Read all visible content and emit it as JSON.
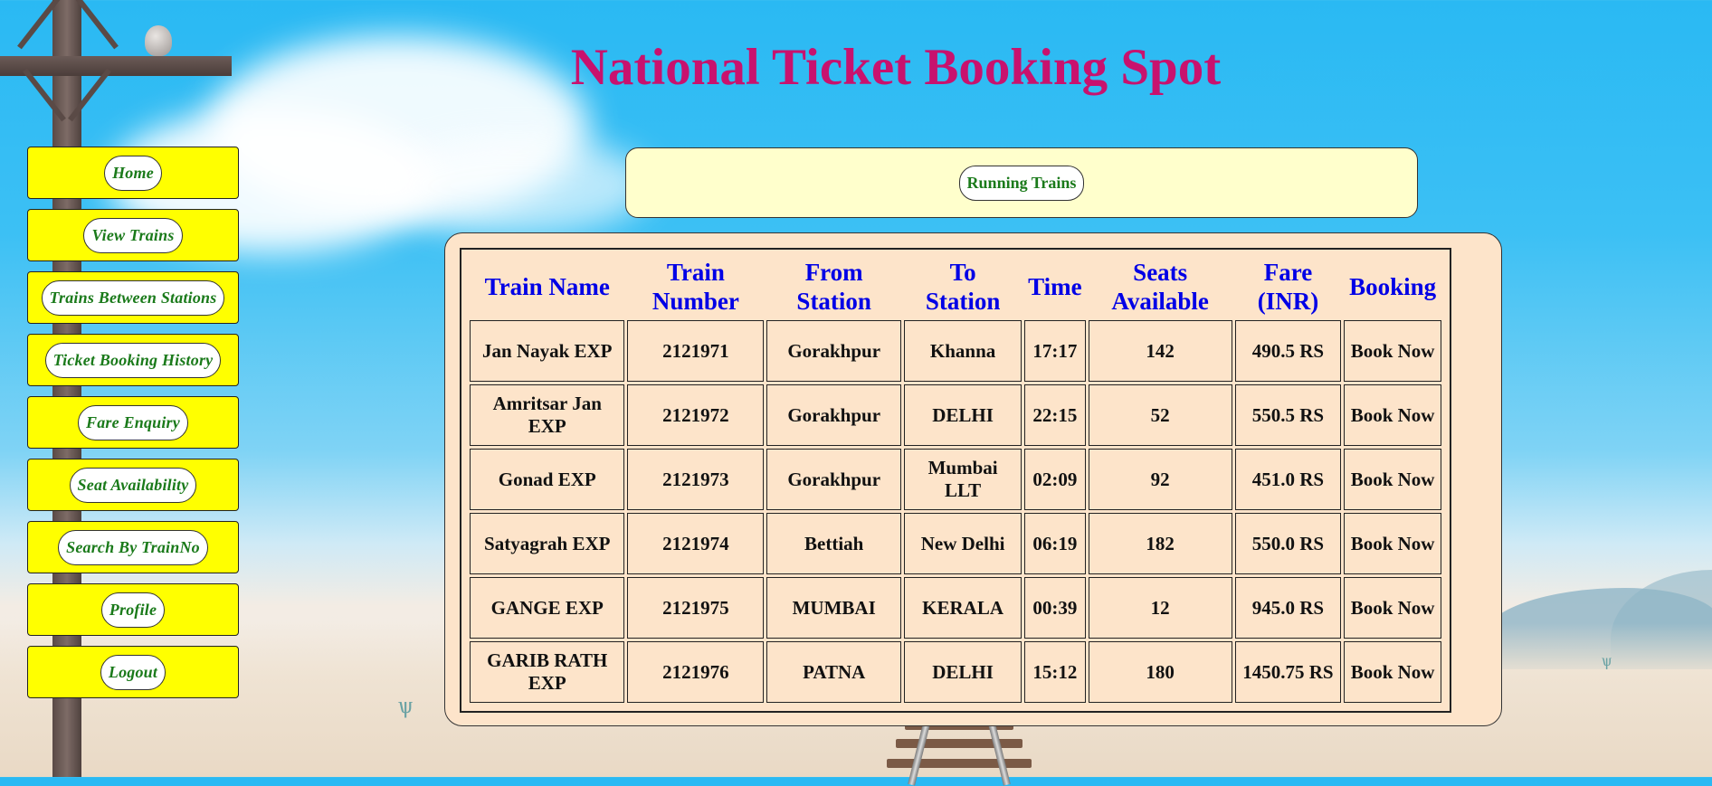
{
  "header": {
    "title": "National Ticket Booking Spot"
  },
  "sidebar": {
    "items": [
      {
        "label": "Home"
      },
      {
        "label": "View Trains"
      },
      {
        "label": "Trains Between Stations"
      },
      {
        "label": "Ticket Booking History"
      },
      {
        "label": "Fare Enquiry"
      },
      {
        "label": "Seat Availability"
      },
      {
        "label": "Search By TrainNo"
      },
      {
        "label": "Profile"
      },
      {
        "label": "Logout"
      }
    ]
  },
  "banner": {
    "label": "Running Trains"
  },
  "table": {
    "headers": {
      "name": [
        "Train Name"
      ],
      "number": [
        "Train",
        "Number"
      ],
      "from": [
        "From",
        "Station"
      ],
      "to": [
        "To",
        "Station"
      ],
      "time": [
        "Time"
      ],
      "seats": [
        "Seats",
        "Available"
      ],
      "fare": [
        "Fare",
        "(INR)"
      ],
      "booking": [
        "Booking"
      ]
    },
    "rows": [
      {
        "name": "Jan Nayak EXP",
        "number": "2121971",
        "from": "Gorakhpur",
        "to": "Khanna",
        "time": "17:17",
        "seats": "142",
        "fare": "490.5 RS",
        "booking": "Book Now"
      },
      {
        "name": "Amritsar Jan EXP",
        "number": "2121972",
        "from": "Gorakhpur",
        "to": "DELHI",
        "time": "22:15",
        "seats": "52",
        "fare": "550.5 RS",
        "booking": "Book Now"
      },
      {
        "name": "Gonad EXP",
        "number": "2121973",
        "from": "Gorakhpur",
        "to": "Mumbai LLT",
        "time": "02:09",
        "seats": "92",
        "fare": "451.0 RS",
        "booking": "Book Now"
      },
      {
        "name": "Satyagrah EXP",
        "number": "2121974",
        "from": "Bettiah",
        "to": "New Delhi",
        "time": "06:19",
        "seats": "182",
        "fare": "550.0 RS",
        "booking": "Book Now"
      },
      {
        "name": "GANGE EXP",
        "number": "2121975",
        "from": "MUMBAI",
        "to": "KERALA",
        "time": "00:39",
        "seats": "12",
        "fare": "945.0 RS",
        "booking": "Book Now"
      },
      {
        "name": "GARIB RATH EXP",
        "number": "2121976",
        "from": "PATNA",
        "to": "DELHI",
        "time": "15:12",
        "seats": "180",
        "fare": "1450.75 RS",
        "booking": "Book Now"
      }
    ]
  }
}
